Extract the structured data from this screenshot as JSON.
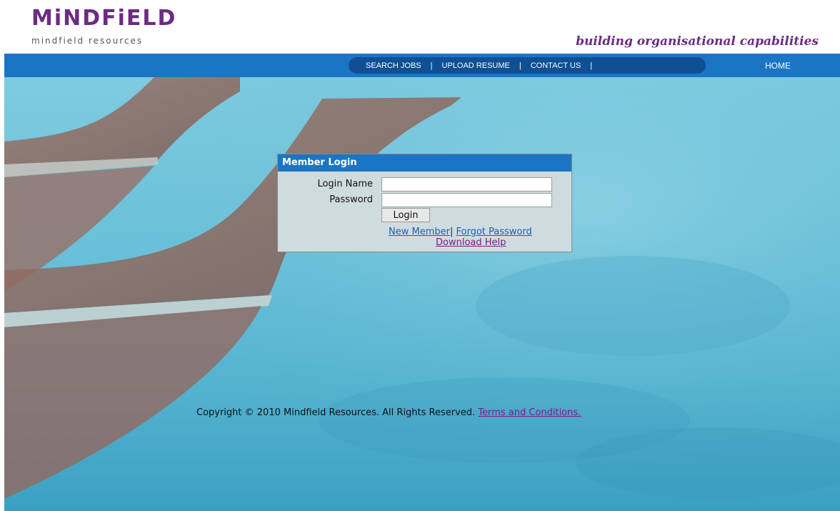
{
  "brand": {
    "logo_text": "MiNDFiELD",
    "logo_subtitle": "mindfield resources",
    "tagline": "building organisational capabilities",
    "color_purple": "#6b2c82"
  },
  "nav": {
    "items": [
      "SEARCH JOBS",
      "UPLOAD RESUME",
      "CONTACT US"
    ],
    "separator": "|",
    "home": "HOME",
    "color": "#1a76c4"
  },
  "login": {
    "title": "Member Login",
    "login_name_label": "Login Name",
    "password_label": "Password",
    "login_name_value": "",
    "password_value": "",
    "button_label": "Login",
    "new_member": "New Member",
    "link_separator": "|",
    "forgot_password": "Forgot Password",
    "download_help": "Download Help"
  },
  "footer": {
    "copyright": "Copyright © 2010 Mindfield Resources. All Rights Reserved.",
    "terms_link": "Terms and Conditions."
  }
}
